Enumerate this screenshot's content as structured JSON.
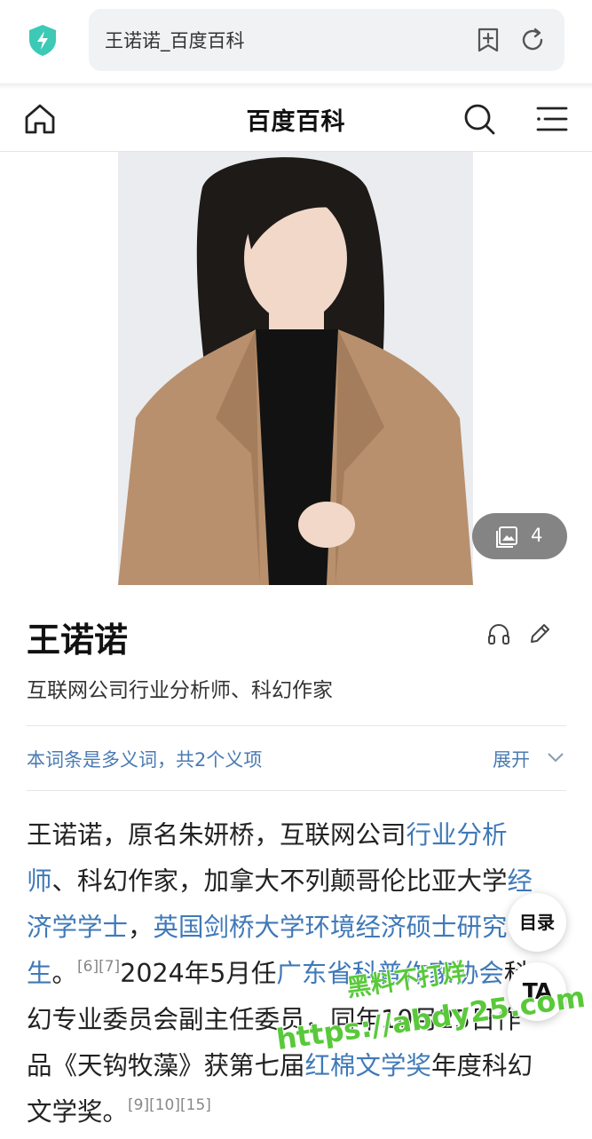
{
  "browser": {
    "url_title": "王诺诺_百度百科",
    "icons": [
      "shield-lightning-icon",
      "add-bookmark-icon",
      "refresh-icon"
    ]
  },
  "header": {
    "site_title": "百度百科",
    "icons": [
      "home-icon",
      "search-icon",
      "menu-icon"
    ]
  },
  "hero": {
    "gallery_count": "4",
    "gallery_icon": "image-gallery-icon"
  },
  "entry": {
    "name": "王诺诺",
    "description": "互联网公司行业分析师、科幻作家",
    "title_icons": [
      "headphones-icon",
      "edit-pencil-icon"
    ]
  },
  "polysemy": {
    "note": "本词条是多义词，共2个义项",
    "expand_label": "展开"
  },
  "summary": {
    "l1_a": "王诺诺，原名朱妍桥，互联网公司",
    "l1_link": "行业分析",
    "l2_link": "师",
    "l2_a": "、科幻作家，加拿大不列颠哥伦比亚大学",
    "l2_link2": "经",
    "l3_link": "济学学士",
    "l3_a": "，",
    "l3_link2": "英国剑桥大学环境经济硕士研究",
    "l4_link": "生",
    "l4_a": "。",
    "l4_ref": "[6][7]",
    "l4_b": "2024年5月任",
    "l4_link2": "广东省科普作家协会",
    "l4_c": "科",
    "l5_a": "幻专业委员会副主任委员，同年10月25日作",
    "l6_a": "品《天钩牧藻》获第七届",
    "l6_link": "红棉文学奖",
    "l6_b": "年度科幻",
    "l7_a": "文学奖。",
    "l7_ref": "[9][10][15]"
  },
  "floating": {
    "toc_label": "目录",
    "font_label": "TA"
  },
  "watermark": {
    "line1": "黑料不打烊",
    "line2": "https://abdy25.com"
  },
  "colors": {
    "link": "#3f79b8",
    "note_blue": "#4b7bb3",
    "shield": "#3cc9b5",
    "watermark": "#59c93a"
  }
}
